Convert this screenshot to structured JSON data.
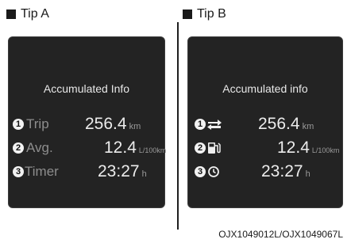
{
  "tips": {
    "a": {
      "label": "Tip A"
    },
    "b": {
      "label": "Tip B"
    }
  },
  "screen_a": {
    "title": "Accumulated Info",
    "rows": [
      {
        "badge": "1",
        "label": "Trip",
        "value": "256.4",
        "unit": "km"
      },
      {
        "badge": "2",
        "label": "Avg.",
        "value": "12.4",
        "unit": "L/100km"
      },
      {
        "badge": "3",
        "label": "Timer",
        "value": "23:27",
        "unit": "h"
      }
    ]
  },
  "screen_b": {
    "title": "Accumulated info",
    "rows": [
      {
        "badge": "1",
        "icon": "trip-distance-icon",
        "value": "256.4",
        "unit": "km"
      },
      {
        "badge": "2",
        "icon": "fuel-pump-icon",
        "value": "12.4",
        "unit": "L/100km"
      },
      {
        "badge": "3",
        "icon": "clock-icon",
        "value": "23:27",
        "unit": "h"
      }
    ]
  },
  "caption": "OJX1049012L/OJX1049067L"
}
